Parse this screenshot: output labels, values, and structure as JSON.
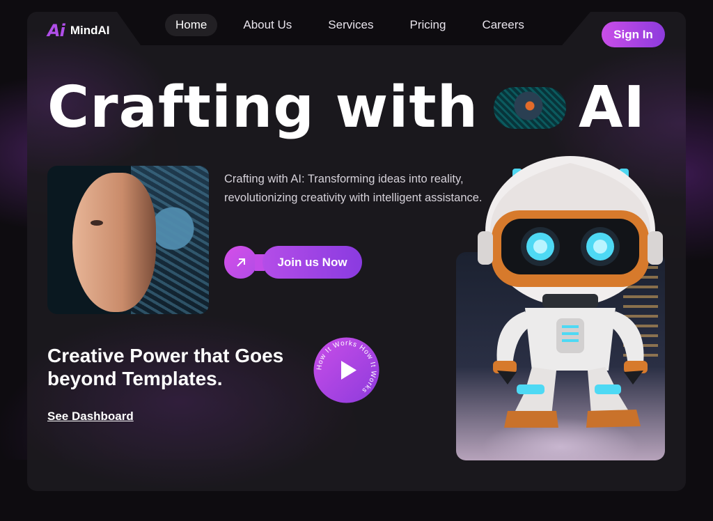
{
  "brand": {
    "logo_mark": "Ai",
    "name": "MindAI"
  },
  "nav": {
    "items": [
      {
        "label": "Home",
        "active": true
      },
      {
        "label": "About Us",
        "active": false
      },
      {
        "label": "Services",
        "active": false
      },
      {
        "label": "Pricing",
        "active": false
      },
      {
        "label": "Careers",
        "active": false
      }
    ],
    "signin_label": "Sign In"
  },
  "hero": {
    "title_part1": "Crafting with",
    "title_part2": "AI",
    "description": "Crafting with AI: Transforming ideas into reality, revolutionizing creativity with intelligent assistance.",
    "join_label": "Join us Now",
    "join_icon": "arrow-up-right-icon",
    "subheading": "Creative Power that Goes beyond Templates.",
    "dashboard_link": "See Dashboard",
    "how_it_works_text": "How It Works How It Works"
  },
  "colors": {
    "accent": "#b04ee8",
    "accent_gradient_start": "#c94ee8",
    "accent_gradient_end": "#8d3bdc",
    "background": "#0e0c10",
    "panel": "#1c1a1e"
  }
}
